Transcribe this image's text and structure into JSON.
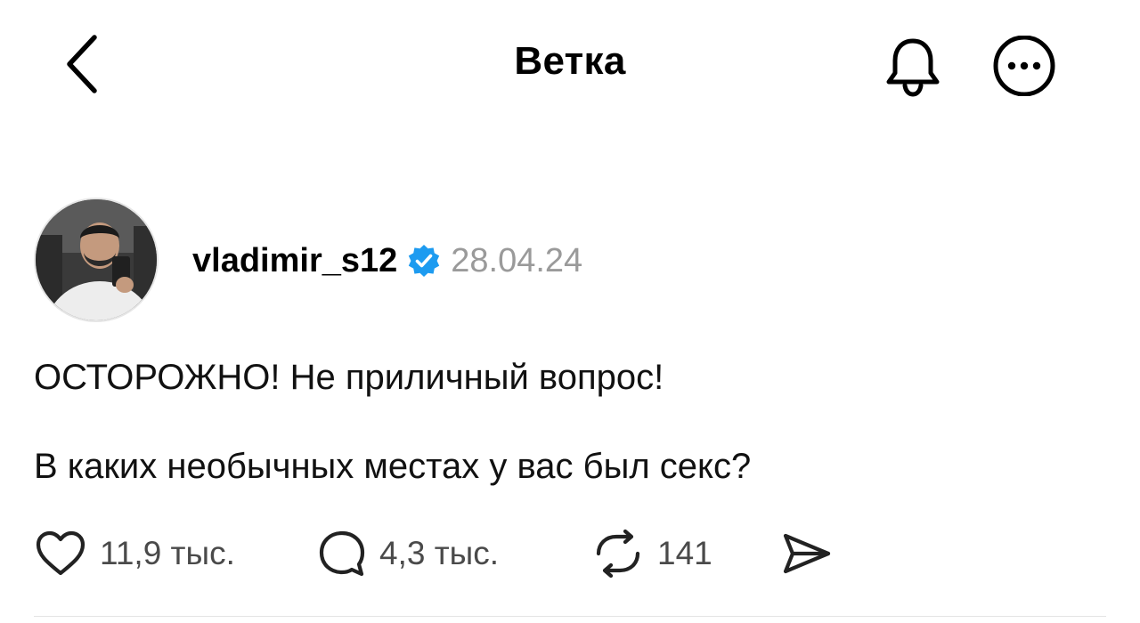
{
  "header": {
    "title": "Ветка",
    "back_icon": "chevron-left-icon",
    "bell_icon": "bell-icon",
    "more_icon": "more-horizontal-icon"
  },
  "post": {
    "author": {
      "username": "vladimir_s12",
      "verified": true,
      "verified_color": "#1d9bf0"
    },
    "date": "28.04.24",
    "text_lines": [
      "ОСТОРОЖНО! Не приличный вопрос!",
      "В каких необычных местах у вас был секс?"
    ],
    "actions": {
      "likes": "11,9 тыс.",
      "replies": "4,3 тыс.",
      "reposts": "141",
      "share_icon": "send-icon"
    }
  },
  "colors": {
    "text": "#000000",
    "muted": "#9a9a9a",
    "count": "#4a4a4a",
    "divider": "#e4e4e4"
  }
}
